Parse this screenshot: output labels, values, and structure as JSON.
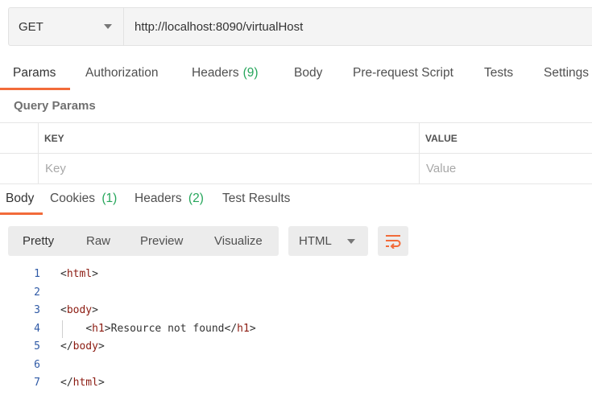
{
  "request": {
    "method": "GET",
    "url": "http://localhost:8090/virtualHost"
  },
  "request_tabs": [
    {
      "label": "Params",
      "count": ""
    },
    {
      "label": "Authorization",
      "count": ""
    },
    {
      "label": "Headers",
      "count": "(9)"
    },
    {
      "label": "Body",
      "count": ""
    },
    {
      "label": "Pre-request Script",
      "count": ""
    },
    {
      "label": "Tests",
      "count": ""
    },
    {
      "label": "Settings",
      "count": ""
    }
  ],
  "query_params": {
    "title": "Query Params",
    "col_key": "KEY",
    "col_value": "VALUE",
    "key_placeholder": "Key",
    "value_placeholder": "Value"
  },
  "response_tabs": [
    {
      "label": "Body",
      "count": ""
    },
    {
      "label": "Cookies",
      "count": "(1)"
    },
    {
      "label": "Headers",
      "count": "(2)"
    },
    {
      "label": "Test Results",
      "count": ""
    }
  ],
  "view_modes": [
    "Pretty",
    "Raw",
    "Preview",
    "Visualize"
  ],
  "format": "HTML",
  "accent_color": "#f26b3a",
  "count_color": "#26a65b",
  "code_lines": [
    {
      "n": "1",
      "text": "<html>"
    },
    {
      "n": "2",
      "text": ""
    },
    {
      "n": "3",
      "text": "<body>"
    },
    {
      "n": "4",
      "text": "    <h1>Resource not found</h1>"
    },
    {
      "n": "5",
      "text": "</body>"
    },
    {
      "n": "6",
      "text": ""
    },
    {
      "n": "7",
      "text": "</html>"
    }
  ]
}
